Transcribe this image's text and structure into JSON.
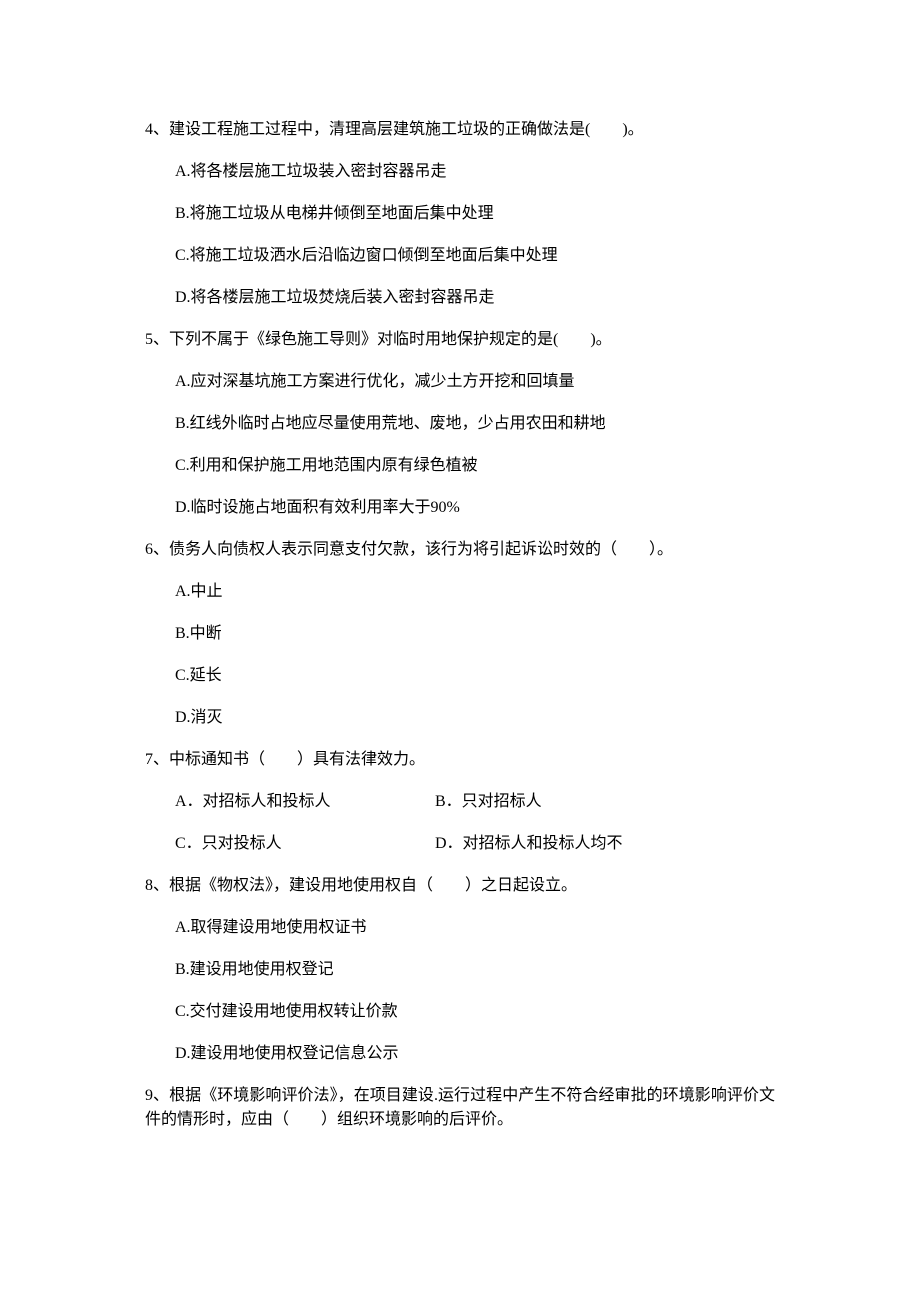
{
  "questions": [
    {
      "num": "4、",
      "stem": "建设工程施工过程中，清理高层建筑施工垃圾的正确做法是(　　)。",
      "options": [
        "A.将各楼层施工垃圾装入密封容器吊走",
        "B.将施工垃圾从电梯井倾倒至地面后集中处理",
        "C.将施工垃圾洒水后沿临边窗口倾倒至地面后集中处理",
        "D.将各楼层施工垃圾焚烧后装入密封容器吊走"
      ]
    },
    {
      "num": "5、",
      "stem": "下列不属于《绿色施工导则》对临时用地保护规定的是(　　)。",
      "options": [
        "A.应对深基坑施工方案进行优化，减少土方开挖和回填量",
        "B.红线外临时占地应尽量使用荒地、废地，少占用农田和耕地",
        "C.利用和保护施工用地范围内原有绿色植被",
        "D.临时设施占地面积有效利用率大于90%"
      ]
    },
    {
      "num": "6、",
      "stem": "债务人向债权人表示同意支付欠款，该行为将引起诉讼时效的（　　）。",
      "options": [
        "A.中止",
        "B.中断",
        "C.延长",
        "D.消灭"
      ]
    },
    {
      "num": "7、",
      "stem": "中标通知书（　　）具有法律效力。",
      "twocol": [
        {
          "left": "A．对招标人和投标人",
          "right": "B．只对招标人"
        },
        {
          "left": "C．只对投标人",
          "right": "D．对招标人和投标人均不"
        }
      ]
    },
    {
      "num": "8、",
      "stem": "根据《物权法》，建设用地使用权自（　　）之日起设立。",
      "options": [
        "A.取得建设用地使用权证书",
        "B.建设用地使用权登记",
        "C.交付建设用地使用权转让价款",
        "D.建设用地使用权登记信息公示"
      ]
    },
    {
      "num": "9、",
      "stem": "根据《环境影响评价法》，在项目建设.运行过程中产生不符合经审批的环境影响评价文件的情形时，应由（　　）组织环境影响的后评价。"
    }
  ]
}
